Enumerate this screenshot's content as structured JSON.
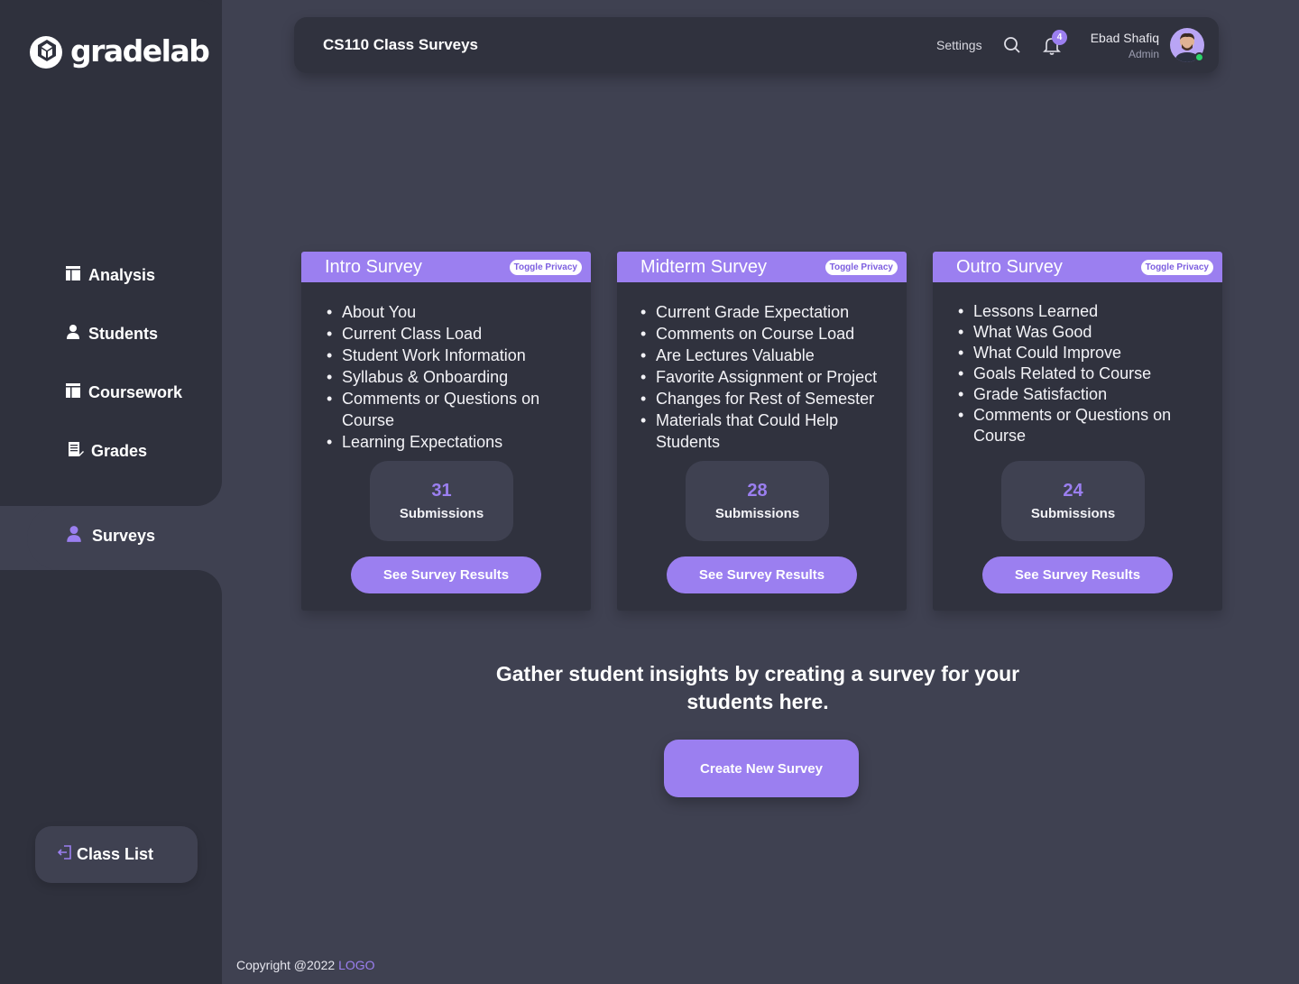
{
  "app": {
    "logo_text": "gradelab"
  },
  "header": {
    "title": "CS110 Class Surveys",
    "settings_label": "Settings",
    "notification_count": "4",
    "user_name": "Ebad Shafiq",
    "user_role": "Admin"
  },
  "sidebar": {
    "items": [
      {
        "label": "Analysis",
        "icon": "table-icon"
      },
      {
        "label": "Students",
        "icon": "user-icon"
      },
      {
        "label": "Coursework",
        "icon": "table-icon"
      },
      {
        "label": "Grades",
        "icon": "document-edit-icon"
      }
    ],
    "active_item": {
      "label": "Surveys",
      "icon": "user-icon"
    },
    "class_list_label": "Class List"
  },
  "surveys": [
    {
      "title": "Intro Survey",
      "privacy_label": "Toggle Privacy",
      "topics": [
        "About You",
        "Current Class Load",
        "Student Work Information",
        "Syllabus & Onboarding",
        "Comments or Questions on Course",
        "Learning Expectations"
      ],
      "submissions": "31",
      "submissions_label": "Submissions",
      "button_label": "See Survey Results"
    },
    {
      "title": "Midterm Survey",
      "privacy_label": "Toggle Privacy",
      "topics": [
        "Current Grade Expectation",
        "Comments on Course Load",
        "Are Lectures Valuable",
        "Favorite Assignment or Project",
        "Changes for Rest of Semester",
        "Materials that Could Help Students"
      ],
      "submissions": "28",
      "submissions_label": "Submissions",
      "button_label": "See Survey Results"
    },
    {
      "title": "Outro Survey",
      "privacy_label": "Toggle Privacy",
      "topics": [
        "Lessons Learned",
        "What Was Good",
        "What Could Improve",
        "Goals Related to Course",
        "Grade Satisfaction",
        "Comments or Questions on Course"
      ],
      "submissions": "24",
      "submissions_label": "Submissions",
      "button_label": "See Survey Results"
    }
  ],
  "cta": {
    "text": "Gather student insights by creating a survey for your students here.",
    "button_label": "Create New Survey"
  },
  "footer": {
    "copyright": "Copyright @2022",
    "logo_link": "LOGO"
  },
  "colors": {
    "accent": "#9b7ff0",
    "background": "#3f4151",
    "panel": "#30323e",
    "online": "#2bd46a"
  }
}
